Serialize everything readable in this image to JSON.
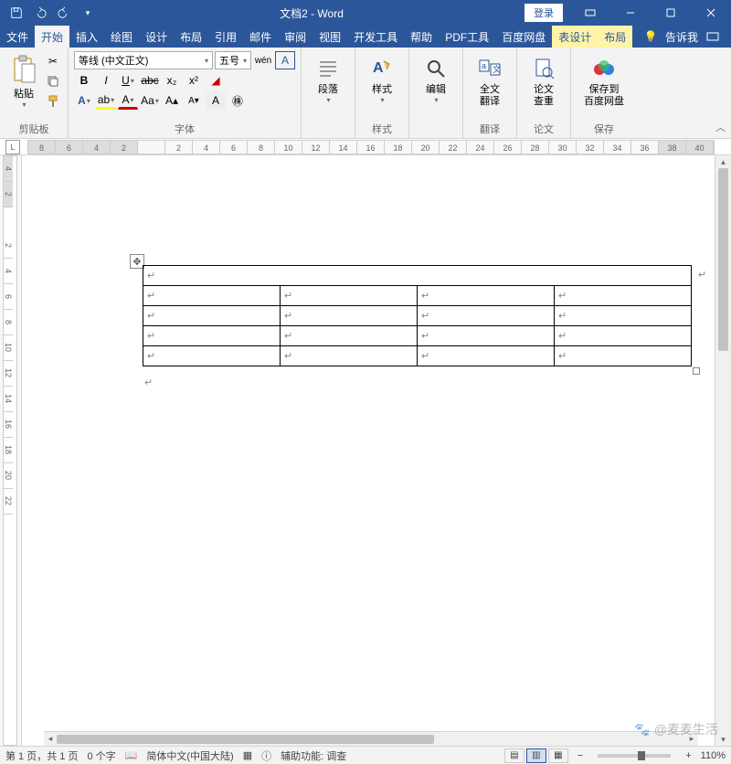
{
  "title": "文档2 - Word",
  "login": "登录",
  "tabs": [
    "文件",
    "开始",
    "插入",
    "绘图",
    "设计",
    "布局",
    "引用",
    "邮件",
    "审阅",
    "视图",
    "开发工具",
    "帮助",
    "PDF工具",
    "百度网盘",
    "表设计",
    "布局"
  ],
  "tell_me": "告诉我",
  "clipboard": {
    "paste": "粘贴",
    "label": "剪贴板"
  },
  "font": {
    "name": "等线 (中文正文)",
    "size": "五号",
    "label": "字体"
  },
  "paragraph": {
    "btn": "段落"
  },
  "styles": {
    "btn": "样式"
  },
  "editing": {
    "btn": "编辑"
  },
  "translate": {
    "btn": "全文\n翻译",
    "label": "翻译"
  },
  "dup": {
    "btn": "论文\n查重",
    "label": "论文"
  },
  "save": {
    "btn": "保存到\n百度网盘",
    "label": "保存"
  },
  "ruler_h": [
    "8",
    "6",
    "4",
    "2",
    "",
    "2",
    "4",
    "6",
    "8",
    "10",
    "12",
    "14",
    "16",
    "18",
    "20",
    "22",
    "24",
    "26",
    "28",
    "30",
    "32",
    "34",
    "36",
    "38",
    "40"
  ],
  "ruler_v": [
    "4",
    "2",
    "",
    "2",
    "4",
    "6",
    "8",
    "10",
    "12",
    "14",
    "16",
    "18",
    "20",
    "22"
  ],
  "table": {
    "rows": 5,
    "cols": 4,
    "merged_first_row": true
  },
  "status": {
    "page": "第 1 页，共 1 页",
    "words": "0 个字",
    "lang": "简体中文(中国大陆)",
    "a11y": "辅助功能: 调查",
    "zoom": "110%"
  },
  "watermark": "@麦麦生活"
}
